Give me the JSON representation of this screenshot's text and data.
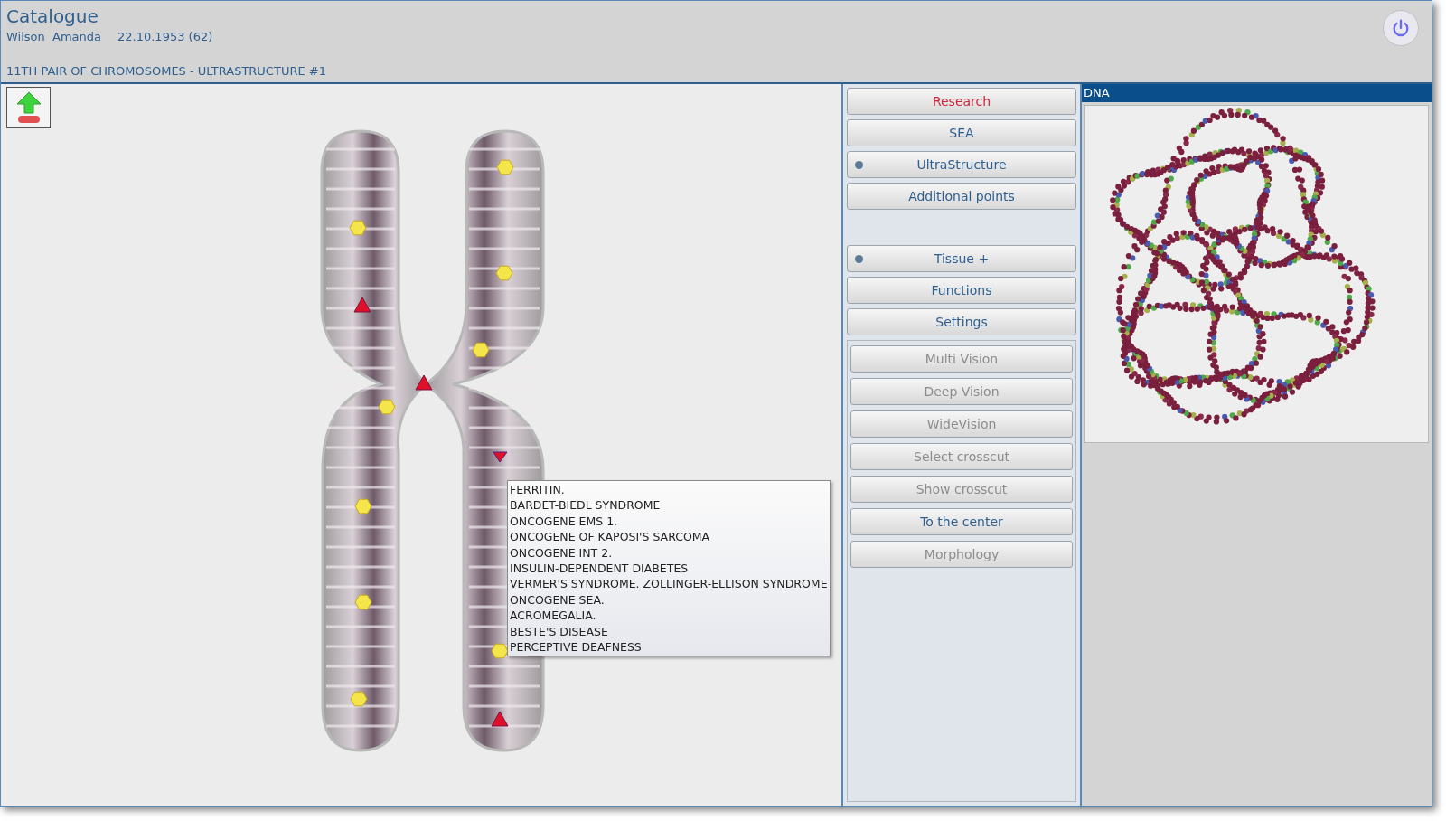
{
  "header": {
    "title": "Catalogue",
    "patient_name": "Wilson  Amanda",
    "birth_date": "22.10.1953 (62)",
    "section_title": "11TH PAIR OF CHROMOSOMES - ULTRASTRUCTURE #1"
  },
  "tooltip": {
    "items": [
      "FERRITIN.",
      "BARDET-BIEDL SYNDROME",
      "ONCOGENE EMS 1.",
      "ONCOGENE OF KAPOSI'S SARCOMA",
      "ONCOGENE INT 2.",
      "INSULIN-DEPENDENT DIABETES",
      "VERMER'S SYNDROME. ZOLLINGER-ELLISON SYNDROME",
      "ONCOGENE SEA.",
      "ACROMEGALIA.",
      "BESTE'S DISEASE",
      "PERCEPTIVE DEAFNESS"
    ]
  },
  "menu_buttons": [
    {
      "label": "Research",
      "kind": "alert",
      "marked": false
    },
    {
      "label": "SEA",
      "kind": "normal",
      "marked": false
    },
    {
      "label": "UltraStructure",
      "kind": "normal",
      "marked": true
    },
    {
      "label": "Additional points",
      "kind": "normal",
      "marked": false
    }
  ],
  "tool_buttons": [
    {
      "label": "Tissue +",
      "marked": true
    },
    {
      "label": "Functions",
      "marked": false
    },
    {
      "label": "Settings",
      "marked": false
    }
  ],
  "view_buttons": [
    {
      "label": "Multi Vision",
      "disabled": true
    },
    {
      "label": "Deep Vision",
      "disabled": true
    },
    {
      "label": "WideVision",
      "disabled": true
    },
    {
      "label": "Select crosscut",
      "disabled": true
    },
    {
      "label": "Show crosscut",
      "disabled": true
    },
    {
      "label": "To the center",
      "disabled": false
    },
    {
      "label": "Morphology",
      "disabled": true
    }
  ],
  "dna_panel": {
    "title": "DNA"
  }
}
